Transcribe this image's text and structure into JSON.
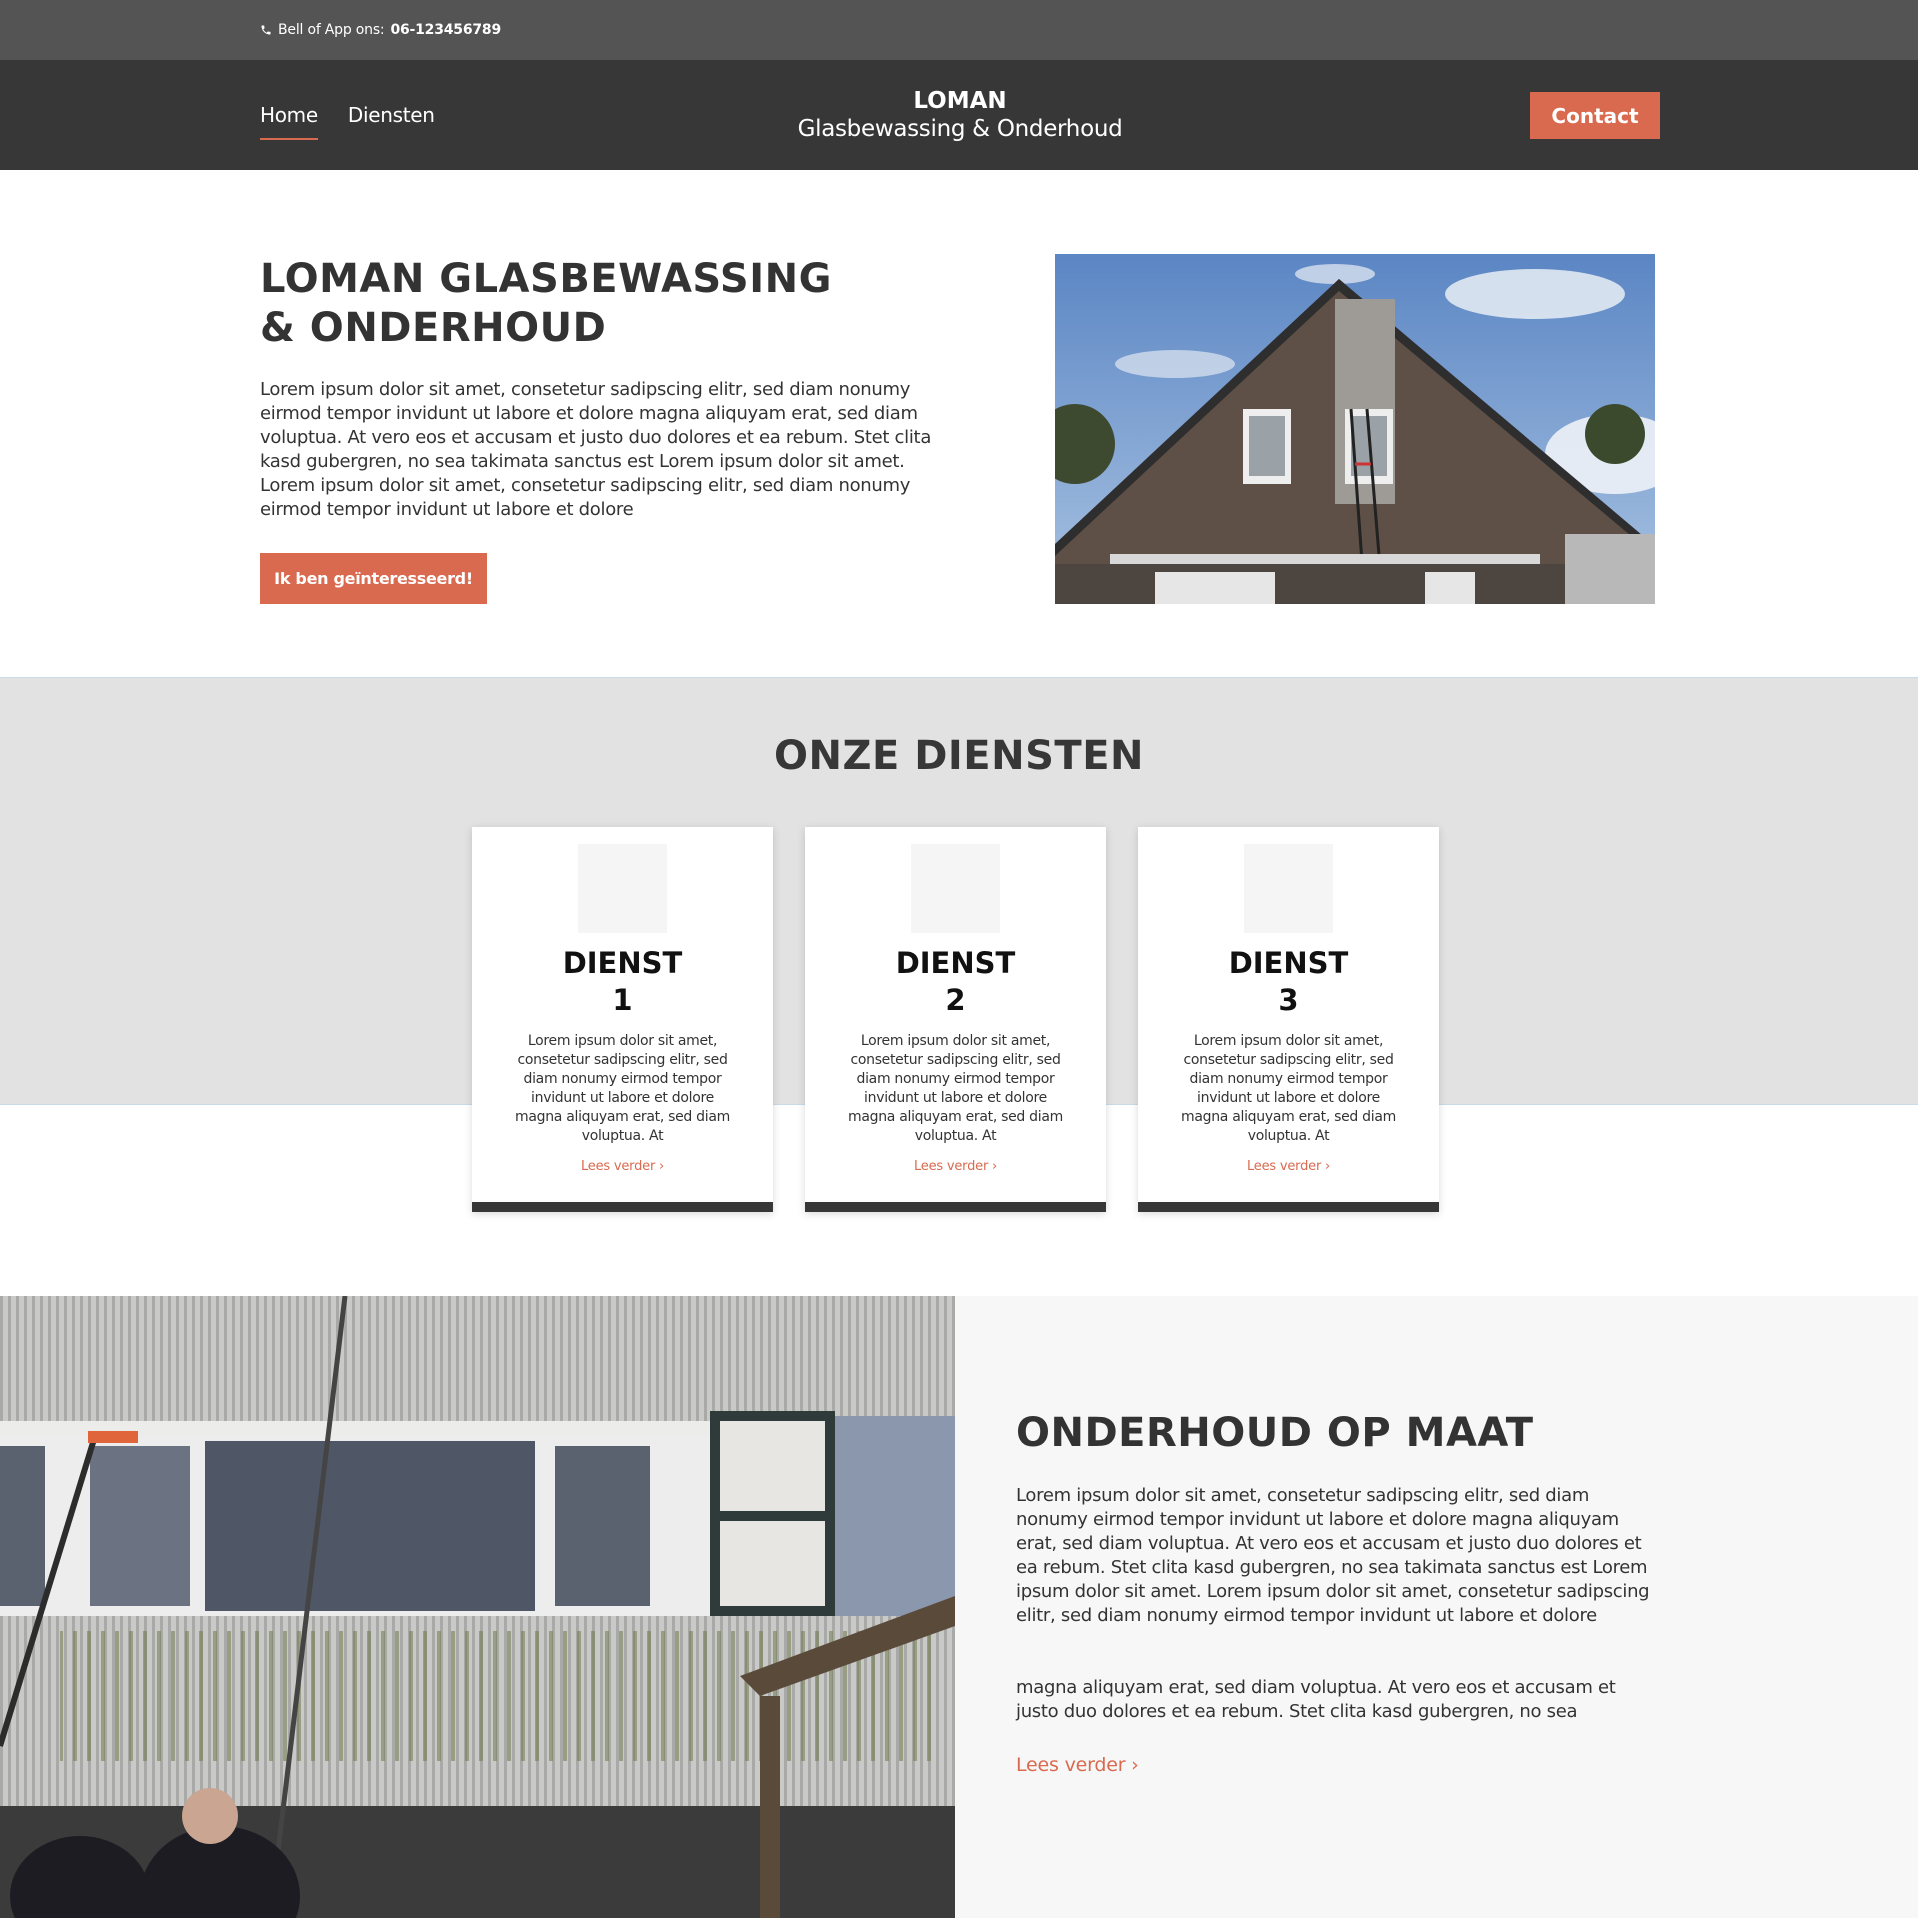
{
  "topbar": {
    "phone_label": "Bell of App ons:",
    "phone_number": "06-123456789",
    "icon": "phone-icon"
  },
  "nav": {
    "items": [
      {
        "label": "Home",
        "active": true
      },
      {
        "label": "Diensten",
        "active": false
      }
    ]
  },
  "brand": {
    "line1": "LOMAN",
    "line2": "Glasbewassing & Onderhoud"
  },
  "header": {
    "contact_label": "Contact"
  },
  "hero": {
    "title_line1": "LOMAN GLASBEWASSING",
    "title_line2": "& ONDERHOUD",
    "text": "Lorem ipsum dolor sit amet, consetetur sadipscing elitr, sed diam nonumy eirmod tempor invidunt ut labore et dolore magna aliquyam erat, sed diam voluptua. At vero eos et accusam et justo duo dolores et ea rebum. Stet clita kasd gubergren, no sea takimata sanctus est Lorem ipsum dolor sit amet. Lorem ipsum dolor sit amet, consetetur sadipscing elitr, sed diam nonumy eirmod tempor invidunt ut labore et dolore",
    "button_label": "Ik ben geïnteresseerd!"
  },
  "diensten": {
    "title": "ONZE DIENSTEN",
    "cards": [
      {
        "title_line1": "DIENST",
        "title_line2": "1",
        "text": "Lorem ipsum dolor sit amet, consetetur sadipscing elitr, sed diam nonumy eirmod tempor invidunt ut labore et dolore magna aliquyam erat, sed diam voluptua. At",
        "link": "Lees verder ›"
      },
      {
        "title_line1": "DIENST",
        "title_line2": "2",
        "text": "Lorem ipsum dolor sit amet, consetetur sadipscing elitr, sed diam nonumy eirmod tempor invidunt ut labore et dolore magna aliquyam erat, sed diam voluptua. At",
        "link": "Lees verder ›"
      },
      {
        "title_line1": "DIENST",
        "title_line2": "3",
        "text": "Lorem ipsum dolor sit amet, consetetur sadipscing elitr, sed diam nonumy eirmod tempor invidunt ut labore et dolore magna aliquyam erat, sed diam voluptua. At",
        "link": "Lees verder ›"
      }
    ]
  },
  "onderhoud": {
    "title": "ONDERHOUD OP MAAT",
    "text1": "Lorem ipsum dolor sit amet, consetetur sadipscing elitr, sed diam nonumy eirmod tempor invidunt ut labore et dolore magna aliquyam erat, sed diam voluptua. At vero eos et accusam et justo duo dolores et ea rebum. Stet clita kasd gubergren, no sea takimata sanctus est Lorem ipsum dolor sit amet. Lorem ipsum dolor sit amet, consetetur sadipscing elitr, sed diam nonumy eirmod tempor invidunt ut labore et dolore",
    "text2": "magna aliquyam erat, sed diam voluptua. At vero eos et accusam et justo duo dolores et ea rebum. Stet clita kasd gubergren, no sea",
    "link": "Lees verder ›"
  },
  "colors": {
    "accent": "#d96a4f",
    "topbar": "#545454",
    "header": "#373737",
    "diensten_bg": "#e2e2e2",
    "panel_bg": "#f7f7f7"
  }
}
